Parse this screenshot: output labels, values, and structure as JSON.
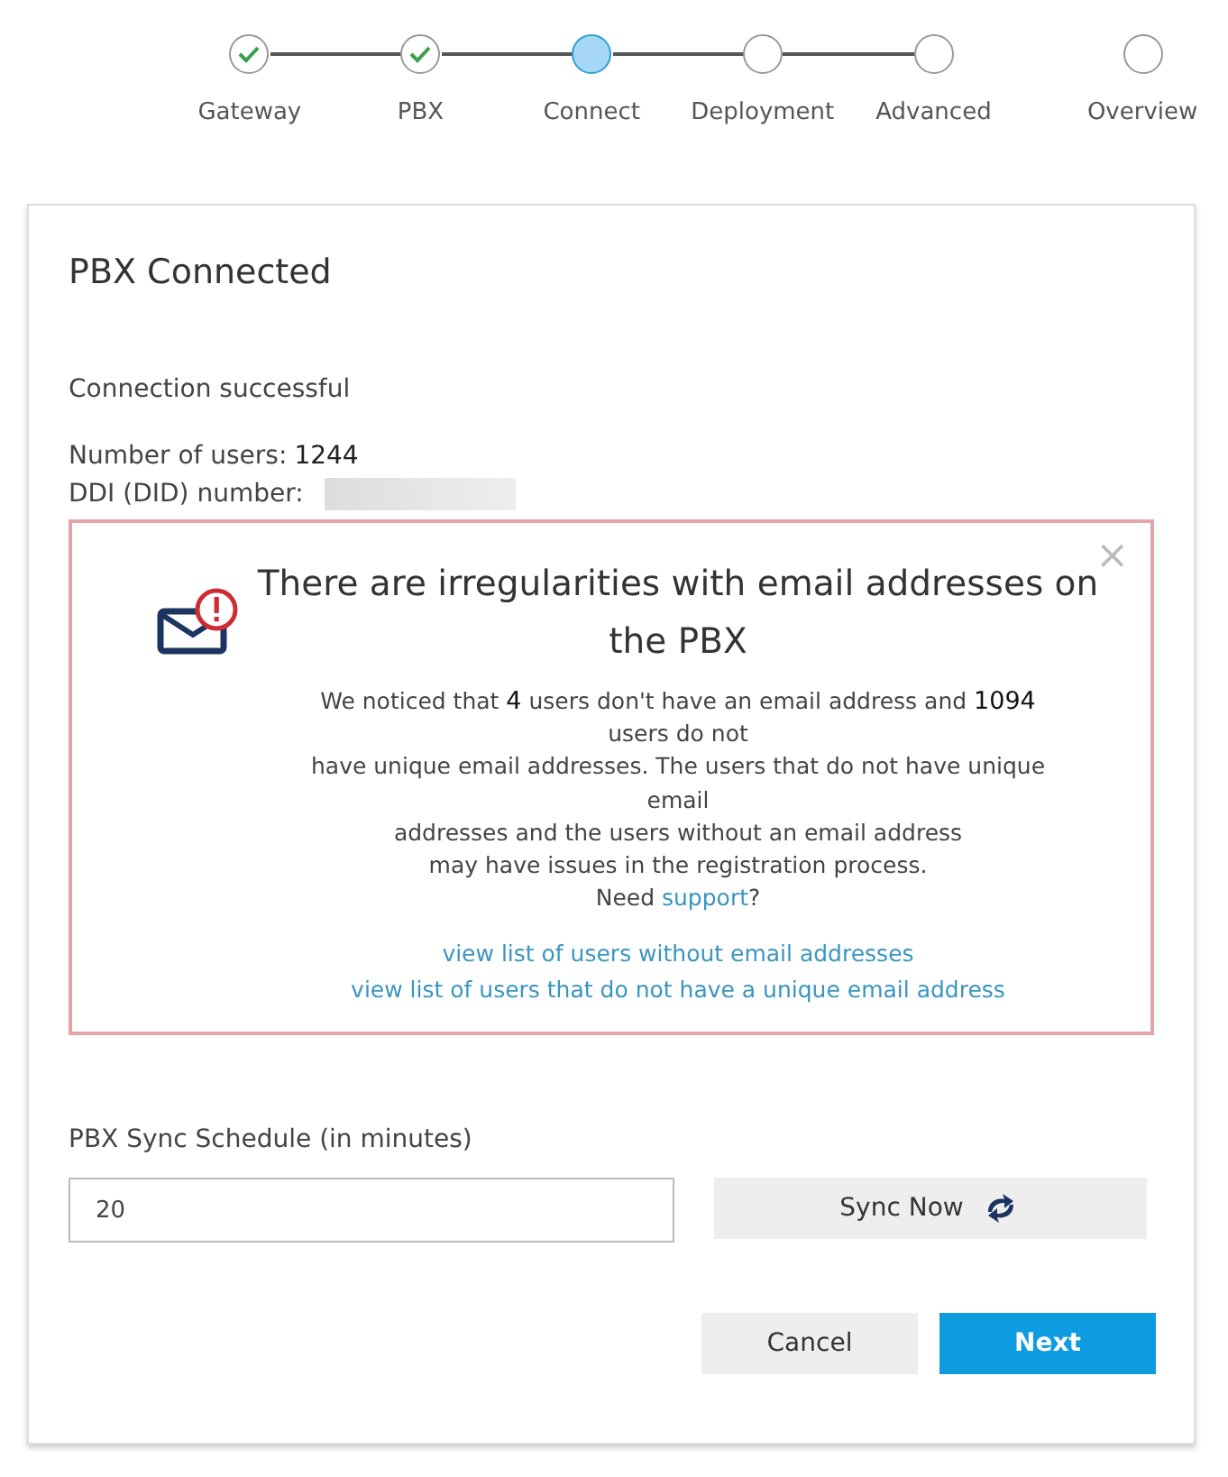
{
  "steps": [
    {
      "label": "Gateway",
      "completed": true,
      "selected": false
    },
    {
      "label": "PBX",
      "completed": true,
      "selected": false
    },
    {
      "label": "Connect",
      "completed": false,
      "selected": true
    },
    {
      "label": "Deployment",
      "completed": false,
      "selected": false
    },
    {
      "label": "Advanced",
      "completed": false,
      "selected": false
    },
    {
      "label": "Overview",
      "completed": false,
      "selected": false
    }
  ],
  "card": {
    "title": "PBX Connected",
    "status_text": "Connection successful",
    "users_label": "Number of users:",
    "users_value": "1244",
    "ddi_label": "DDI (DID) number:"
  },
  "alert": {
    "close": "×",
    "title": "There are irregularities with email addresses on the PBX",
    "lines": [
      "We noticed that **4** users don't have an email address and **1094**",
      "users do not",
      "have unique email addresses. The users that do not have unique",
      "email",
      "addresses and the users without an email address",
      "may have issues in the registration process."
    ],
    "need_before": "Need ",
    "need_link": "support",
    "need_after": "?",
    "links": [
      "view list of users without email addresses",
      "view list of users that do not have a unique email address"
    ]
  },
  "sync": {
    "label": "PBX Sync Schedule (in minutes)",
    "value": "20",
    "button": "Sync Now"
  },
  "buttons": {
    "cancel": "Cancel",
    "next": "Next"
  }
}
